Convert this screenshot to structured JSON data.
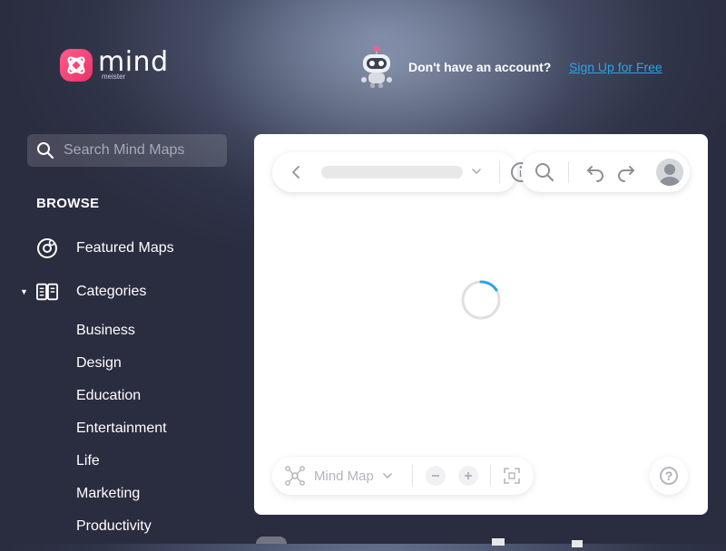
{
  "brand": {
    "name": "mind",
    "sub": "meister",
    "accent": "#e8336a"
  },
  "header": {
    "account_prompt": "Don't have an account?",
    "signup_link": "Sign Up for Free",
    "link_color": "#2aa5e8"
  },
  "sidebar": {
    "search_placeholder": "Search Mind Maps",
    "browse_heading": "BROWSE",
    "featured": {
      "label": "Featured Maps",
      "icon": "featured-icon"
    },
    "categories": {
      "label": "Categories",
      "icon": "book-icon",
      "expanded": true,
      "items": [
        "Business",
        "Design",
        "Education",
        "Entertainment",
        "Life",
        "Marketing",
        "Productivity"
      ]
    }
  },
  "viewer": {
    "state": "loading",
    "map_type_label": "Mind Map",
    "spinner_color": "#2aa5e8"
  }
}
